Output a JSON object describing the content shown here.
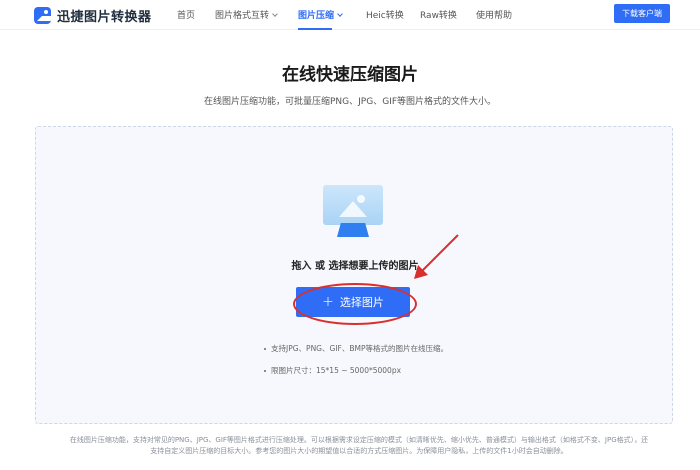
{
  "header": {
    "logo_text": "迅捷图片转换器",
    "nav": [
      {
        "label": "首页",
        "active": false,
        "dropdown": false
      },
      {
        "label": "图片格式互转",
        "active": false,
        "dropdown": true
      },
      {
        "label": "图片压缩",
        "active": true,
        "dropdown": true
      },
      {
        "label": "Heic转换",
        "active": false,
        "dropdown": false
      },
      {
        "label": "Raw转换",
        "active": false,
        "dropdown": false
      },
      {
        "label": "使用帮助",
        "active": false,
        "dropdown": false
      }
    ],
    "download_label": "下载客户端"
  },
  "page": {
    "title": "在线快速压缩图片",
    "subtitle": "在线图片压缩功能，可批量压缩PNG、JPG、GIF等图片格式的文件大小。"
  },
  "upload": {
    "prompt": "拖入 或 选择想要上传的图片",
    "button_label": "选择图片",
    "hints": [
      "支持JPG、PNG、GIF、BMP等格式的图片在线压缩。",
      "限图片尺寸：15*15 ~ 5000*5000px"
    ]
  },
  "footer": {
    "text": "在线图片压缩功能，支持对常见的PNG、JPG、GIF等图片格式进行压缩处理。可以根据需求设定压缩的模式（如清晰优先、缩小优先、普通模式）与输出格式（如格式不变、JPG格式），还支持自定义图片压缩的目标大小。参考您的图片大小的期望值以合适的方式压缩图片。为保障用户隐私，上传的文件1小时会自动删除。"
  },
  "colors": {
    "accent": "#2f6df6",
    "annotation_red": "#d8302f"
  }
}
